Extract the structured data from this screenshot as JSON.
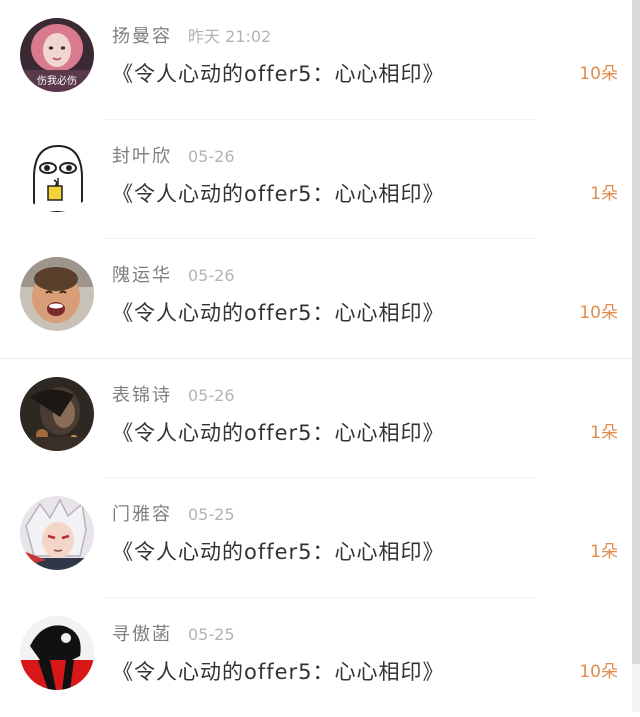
{
  "gifts": [
    {
      "name": "扬曼容",
      "time": "昨天 21:02",
      "message": "《令人心动的offer5：心心相印》",
      "amount": "10朵",
      "avatar_icon": "girl-pink-hair-avatar",
      "avatar_text": "伤我必伤"
    },
    {
      "name": "封叶欣",
      "time": "05-26",
      "message": "《令人心动的offer5：心心相印》",
      "amount": "1朵",
      "avatar_icon": "cartoon-face-drinking-avatar"
    },
    {
      "name": "隗运华",
      "time": "05-26",
      "message": "《令人心动的offer5：心心相印》",
      "amount": "10朵",
      "avatar_icon": "laughing-baby-avatar"
    },
    {
      "name": "表锦诗",
      "time": "05-26",
      "message": "《令人心动的offer5：心心相印》",
      "amount": "1朵",
      "avatar_icon": "dark-portrait-avatar"
    },
    {
      "name": "门雅容",
      "time": "05-25",
      "message": "《令人心动的offer5：心心相印》",
      "amount": "1朵",
      "avatar_icon": "anime-character-avatar"
    },
    {
      "name": "寻傲菡",
      "time": "05-25",
      "message": "《令人心动的offer5：心心相印》",
      "amount": "10朵",
      "avatar_icon": "red-black-figure-avatar"
    }
  ],
  "colors": {
    "amount": "#e08d4e",
    "name": "#7f7f7f",
    "time": "#b3b3b3",
    "message": "#333333"
  }
}
